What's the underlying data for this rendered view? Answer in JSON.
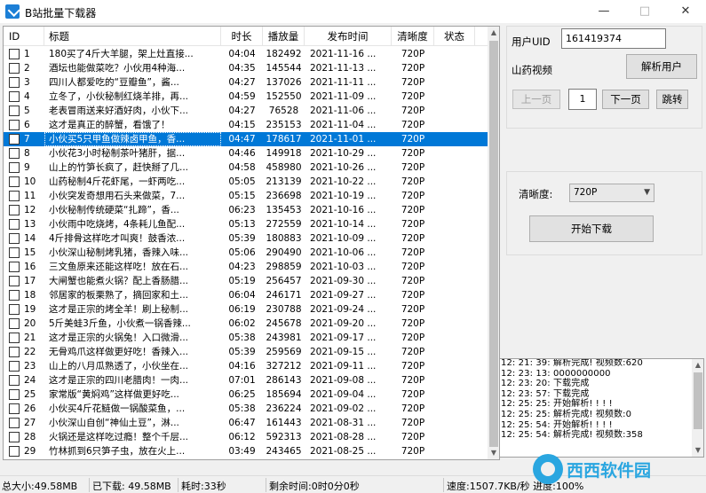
{
  "window": {
    "title": "B站批量下载器"
  },
  "table": {
    "headers": {
      "id": "ID",
      "title": "标题",
      "duration": "时长",
      "plays": "播放量",
      "date": "发布时间",
      "res": "清晰度",
      "status": "状态"
    },
    "rows": [
      {
        "id": "1",
        "title": "180买了4斤大羊腿，架上灶直接...",
        "duration": "04:04",
        "plays": "182492",
        "date": "2021-11-16 ...",
        "res": "720P"
      },
      {
        "id": "2",
        "title": "酒坛也能做菜吃？小伙用4种海...",
        "duration": "04:35",
        "plays": "145544",
        "date": "2021-11-13 ...",
        "res": "720P"
      },
      {
        "id": "3",
        "title": "四川人都爱吃的“豆瓣鱼”，酱...",
        "duration": "04:27",
        "plays": "137026",
        "date": "2021-11-11 ...",
        "res": "720P"
      },
      {
        "id": "4",
        "title": "立冬了，小伙秘制红烧羊排，再...",
        "duration": "04:59",
        "plays": "152550",
        "date": "2021-11-09 ...",
        "res": "720P"
      },
      {
        "id": "5",
        "title": "老表冒雨送来好酒好肉，小伙下...",
        "duration": "04:27",
        "plays": "76528",
        "date": "2021-11-06 ...",
        "res": "720P"
      },
      {
        "id": "6",
        "title": "这才是真正的醉蟹，看饿了！",
        "duration": "04:15",
        "plays": "235153",
        "date": "2021-11-04 ...",
        "res": "720P"
      },
      {
        "id": "7",
        "title": "小伙买5只甲鱼做辣卤甲鱼，香...",
        "duration": "04:47",
        "plays": "178617",
        "date": "2021-11-01 ...",
        "res": "720P",
        "selected": true
      },
      {
        "id": "8",
        "title": "小伙花3小时秘制茶叶猪肝，据...",
        "duration": "04:46",
        "plays": "149918",
        "date": "2021-10-29 ...",
        "res": "720P"
      },
      {
        "id": "9",
        "title": "山上的竹笋长疯了，赶快掰了几...",
        "duration": "04:58",
        "plays": "458980",
        "date": "2021-10-26 ...",
        "res": "720P"
      },
      {
        "id": "10",
        "title": "山药秘制4斤花虾尾，一虾两吃...",
        "duration": "05:05",
        "plays": "213139",
        "date": "2021-10-22 ...",
        "res": "720P"
      },
      {
        "id": "11",
        "title": "小伙突发奇想用石头来做菜，7...",
        "duration": "05:15",
        "plays": "236698",
        "date": "2021-10-19 ...",
        "res": "720P"
      },
      {
        "id": "12",
        "title": "小伙秘制传统硬菜“扎蹄”，香...",
        "duration": "06:23",
        "plays": "135453",
        "date": "2021-10-16 ...",
        "res": "720P"
      },
      {
        "id": "13",
        "title": "小伙雨中吃烧烤，4条耗儿鱼配...",
        "duration": "05:13",
        "plays": "272559",
        "date": "2021-10-14 ...",
        "res": "720P"
      },
      {
        "id": "14",
        "title": "4斤排骨这样吃才叫爽！鼓香浓...",
        "duration": "05:39",
        "plays": "180883",
        "date": "2021-10-09 ...",
        "res": "720P"
      },
      {
        "id": "15",
        "title": "小伙深山秘制烤乳猪，香辣入味...",
        "duration": "05:06",
        "plays": "290490",
        "date": "2021-10-06 ...",
        "res": "720P"
      },
      {
        "id": "16",
        "title": "三文鱼原来还能这样吃！放在石...",
        "duration": "04:23",
        "plays": "298859",
        "date": "2021-10-03 ...",
        "res": "720P"
      },
      {
        "id": "17",
        "title": "大闸蟹也能煮火锅？配上香肠腊...",
        "duration": "05:19",
        "plays": "256457",
        "date": "2021-09-30 ...",
        "res": "720P"
      },
      {
        "id": "18",
        "title": "邻居家的板栗熟了，摘回家和土...",
        "duration": "06:04",
        "plays": "246171",
        "date": "2021-09-27 ...",
        "res": "720P"
      },
      {
        "id": "19",
        "title": "这才是正宗的烤全羊！刷上秘制...",
        "duration": "06:19",
        "plays": "230788",
        "date": "2021-09-24 ...",
        "res": "720P"
      },
      {
        "id": "20",
        "title": "5斤美蛙3斤鱼，小伙煮一锅香辣...",
        "duration": "06:02",
        "plays": "245678",
        "date": "2021-09-20 ...",
        "res": "720P"
      },
      {
        "id": "21",
        "title": "这才是正宗的火锅兔！入口微滑...",
        "duration": "05:38",
        "plays": "243981",
        "date": "2021-09-17 ...",
        "res": "720P"
      },
      {
        "id": "22",
        "title": "无骨鸡爪这样做更好吃！香辣入...",
        "duration": "05:39",
        "plays": "259569",
        "date": "2021-09-15 ...",
        "res": "720P"
      },
      {
        "id": "23",
        "title": "山上的八月瓜熟透了，小伙坐在...",
        "duration": "04:16",
        "plays": "327212",
        "date": "2021-09-11 ...",
        "res": "720P"
      },
      {
        "id": "24",
        "title": "这才是正宗的四川老腊肉！一肉...",
        "duration": "07:01",
        "plays": "286143",
        "date": "2021-09-08 ...",
        "res": "720P"
      },
      {
        "id": "25",
        "title": "家常版“黄焖鸡”这样做更好吃...",
        "duration": "06:25",
        "plays": "185694",
        "date": "2021-09-04 ...",
        "res": "720P"
      },
      {
        "id": "26",
        "title": "小伙买4斤花鲢做一锅酸菜鱼，...",
        "duration": "05:38",
        "plays": "236224",
        "date": "2021-09-02 ...",
        "res": "720P"
      },
      {
        "id": "27",
        "title": "小伙深山自创“神仙土豆”，淋...",
        "duration": "06:47",
        "plays": "161443",
        "date": "2021-08-31 ...",
        "res": "720P"
      },
      {
        "id": "28",
        "title": "火锅还是这样吃过瘾！整个千层...",
        "duration": "06:12",
        "plays": "592313",
        "date": "2021-08-28 ...",
        "res": "720P"
      },
      {
        "id": "29",
        "title": "竹林抓到6只笋子虫，放在火上...",
        "duration": "03:49",
        "plays": "243465",
        "date": "2021-08-25 ...",
        "res": "720P"
      }
    ]
  },
  "user_panel": {
    "uid_label": "用户UID",
    "uid_value": "161419374",
    "user_name": "山药视频",
    "parse_button": "解析用户",
    "prev_button": "上一页",
    "page_value": "1",
    "next_button": "下一页",
    "jump_button": "跳转"
  },
  "download_panel": {
    "res_label": "清晰度:",
    "res_value": "720P",
    "start_button": "开始下载"
  },
  "log": [
    "12: 21: 39: 解析完成! 视频数:620",
    "12: 23: 13: 0000000000",
    "12: 23: 20: 下载完成",
    "12: 23: 57: 下载完成",
    "12: 25: 25: 开始解析! ! ! !",
    "12: 25: 25: 解析完成! 视频数:0",
    "12: 25: 54: 开始解析! ! ! !",
    "12: 25: 54: 解析完成! 视频数:358"
  ],
  "status": {
    "total": "总大小:49.58MB",
    "downloaded": "已下载: 49.58MB",
    "elapsed": "耗时:33秒",
    "remaining": "剩余时间:0时0分0秒",
    "speed": "速度:1507.7KB/秒 进度:100%"
  },
  "watermark": {
    "brand": "西西软件园",
    "small": "CR"
  }
}
